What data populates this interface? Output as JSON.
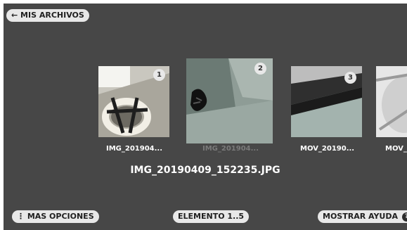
{
  "nav": {
    "back_label": "← MIS ARCHIVOS"
  },
  "thumbnails": [
    {
      "index": "1",
      "caption": "IMG_201904..."
    },
    {
      "index": "2",
      "caption": "IMG_201904..."
    },
    {
      "index": "3",
      "caption": "MOV_20190..."
    },
    {
      "index": "",
      "caption": "MOV_"
    }
  ],
  "current_file": "IMG_20190409_152235.JPG",
  "bottom": {
    "more_options": "⋮ MAS OPCIONES",
    "element_count": "ELEMENTO 1..5",
    "help": "MOSTRAR AYUDA",
    "help_icon": "?"
  },
  "colors": {
    "background": "#474747",
    "pill": "#e8e8e8",
    "text": "#ffffff"
  }
}
